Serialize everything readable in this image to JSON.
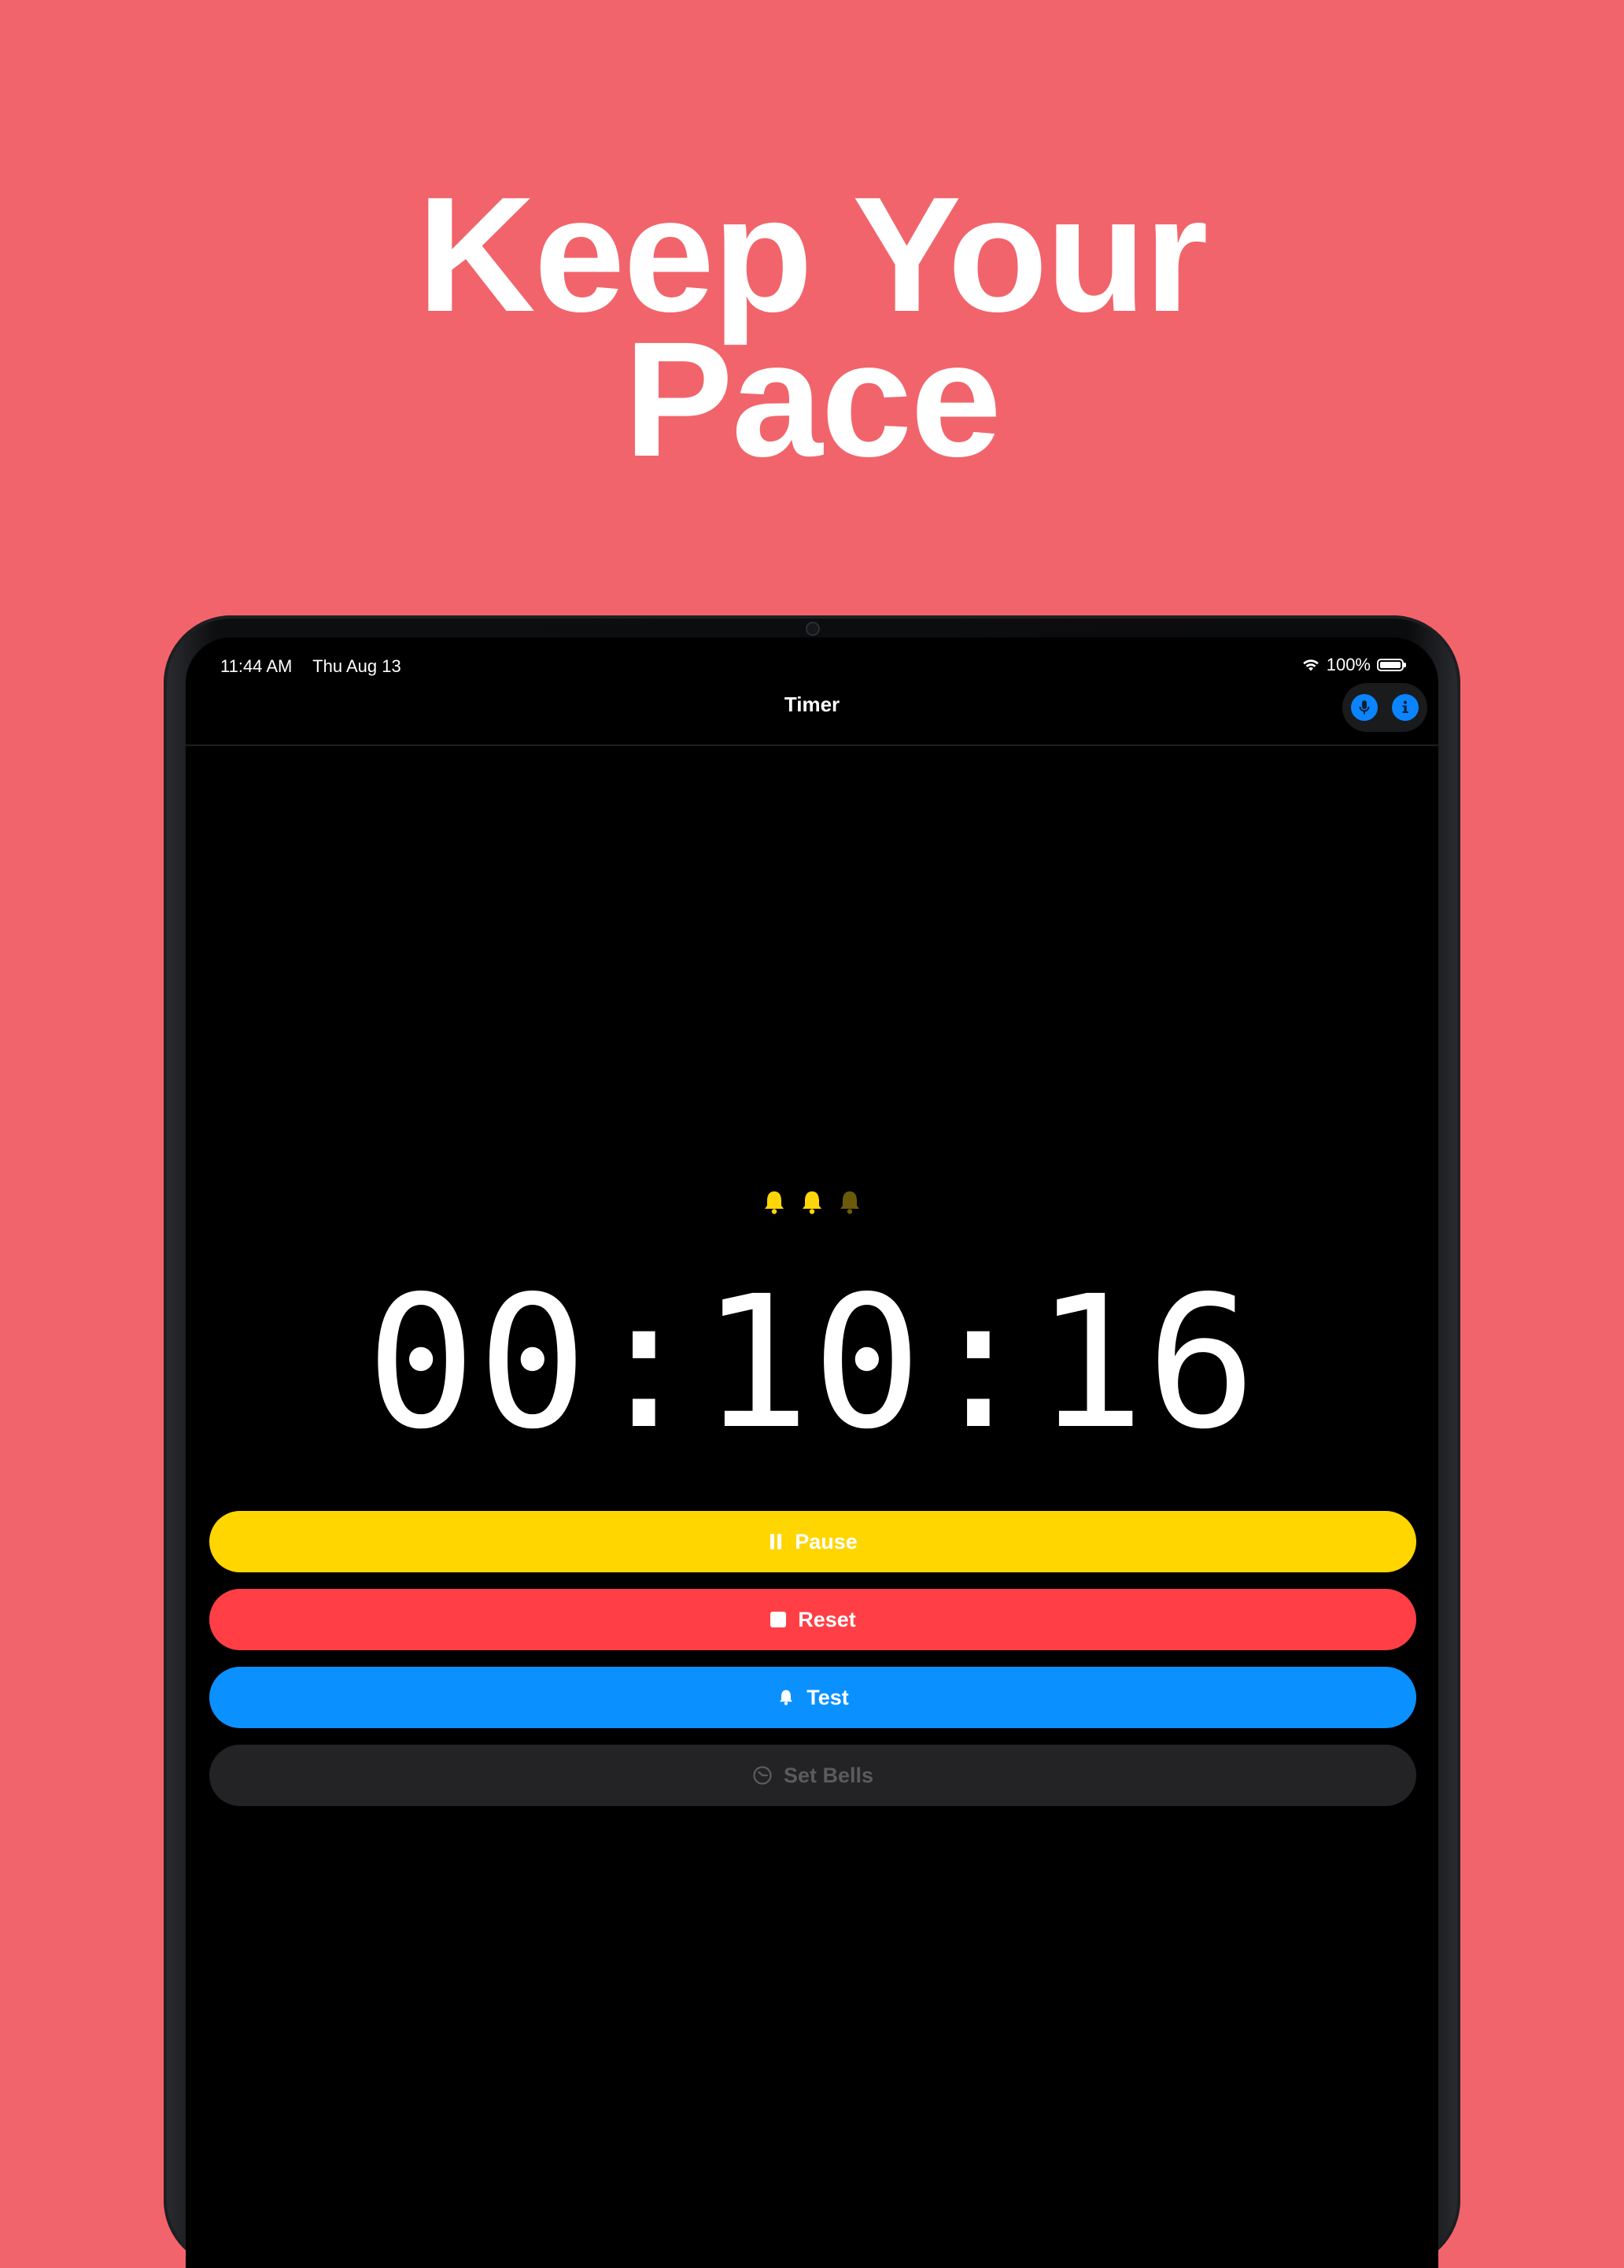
{
  "headline": {
    "line1": "Keep Your",
    "line2": "Pace"
  },
  "status_bar": {
    "time": "11:44 AM",
    "date": "Thu Aug 13",
    "battery": "100%",
    "icons": [
      "wifi-icon",
      "battery-icon"
    ]
  },
  "nav": {
    "title": "Timer",
    "icons": [
      "microphone-icon",
      "info-icon"
    ]
  },
  "bells": {
    "count_total": 3,
    "count_active": 2,
    "active_color": "#ffd60a",
    "inactive_color": "#6b5a0a"
  },
  "timer": {
    "display": "00:10:16"
  },
  "buttons": {
    "pause": {
      "label": "Pause",
      "icon": "pause-icon",
      "color": "#ffd600"
    },
    "reset": {
      "label": "Reset",
      "icon": "stop-icon",
      "color": "#ff3f45"
    },
    "test": {
      "label": "Test",
      "icon": "bell-icon",
      "color": "#0a91ff"
    },
    "set_bells": {
      "label": "Set Bells",
      "icon": "timer-icon",
      "color": "#232326"
    }
  },
  "colors": {
    "background": "#f2646b",
    "screen": "#000000",
    "accent": "#0a84ff"
  }
}
